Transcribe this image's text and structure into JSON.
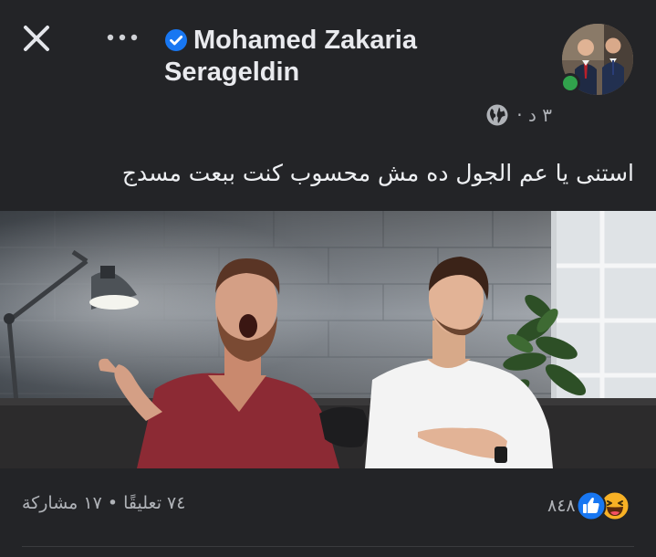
{
  "header": {
    "author_line_1": "Mohamed Zakaria",
    "author_line_2": "Serageldin",
    "time": "٣ د ·"
  },
  "post": {
    "text": "استنى يا عم الجول ده مش محسوب كنت ببعت مسدج"
  },
  "footer": {
    "reaction_count": "٨٤٨",
    "comments": "٧٤ تعليقًا",
    "separator": "•",
    "shares": "١٧ مشاركة"
  },
  "icons": {
    "close": "close-icon",
    "more": "more-horizontal-icon",
    "verified": "verified-badge-icon",
    "privacy": "globe-icon",
    "reactions": [
      "haha-icon",
      "like-icon"
    ]
  },
  "colors": {
    "background": "#232427",
    "verified_blue": "#1877f2",
    "online_green": "#31a24c",
    "secondary_text": "#b0b3b8",
    "reaction_yellow": "#f7b125"
  }
}
